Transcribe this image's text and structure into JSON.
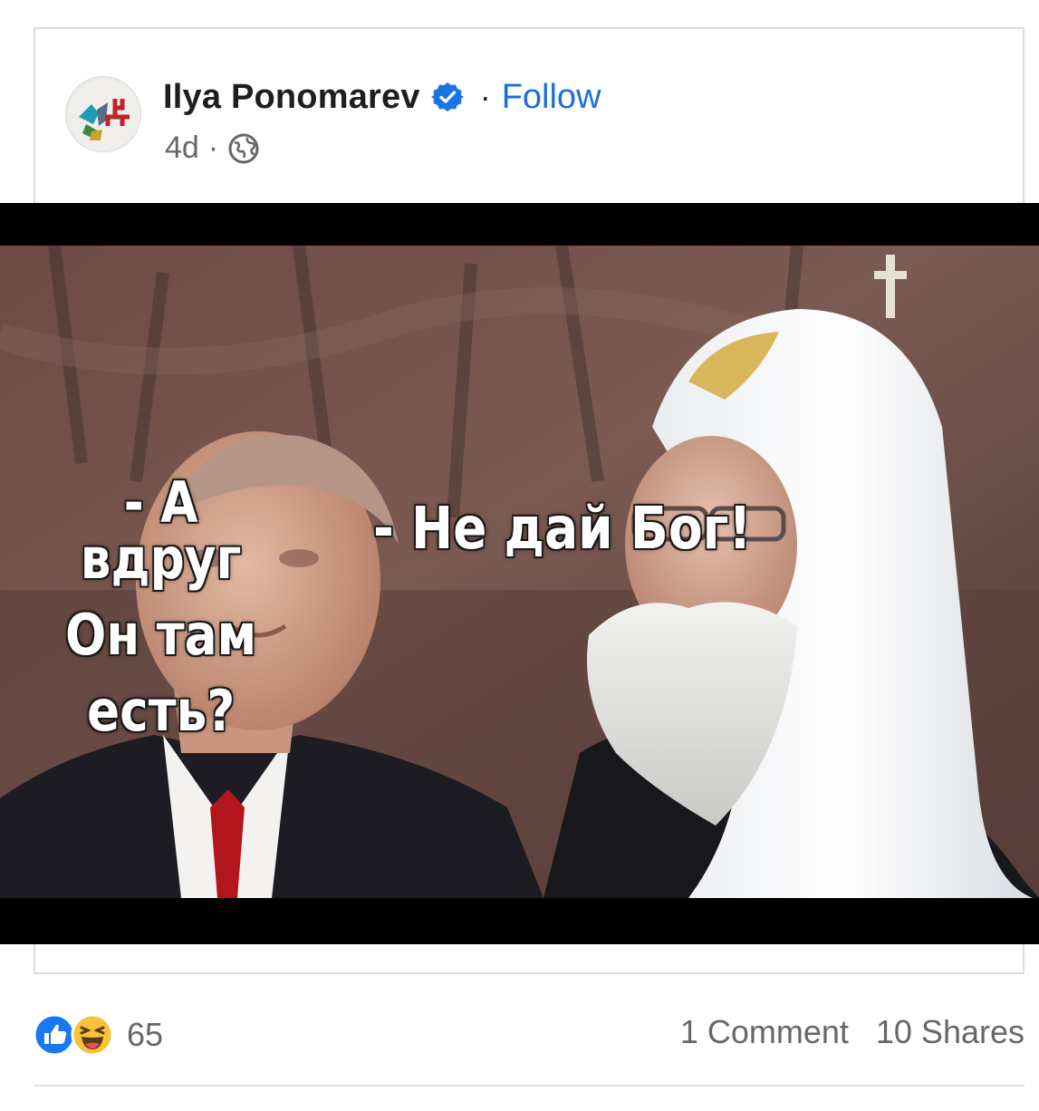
{
  "post": {
    "author": "Ilya Ponomarev",
    "verified_icon": "verified-badge-icon",
    "separator": "·",
    "follow_label": "Follow",
    "time": "4d",
    "meta_separator": "·",
    "audience_icon": "globe-icon"
  },
  "image": {
    "caption_left_lines": [
      "- А вдруг",
      "Он там",
      "есть?"
    ],
    "caption_right": "- Не дай Бог!"
  },
  "footer": {
    "reaction_icons": [
      "like-icon",
      "haha-icon"
    ],
    "reaction_count": "65",
    "comments": "1 Comment",
    "shares": "10 Shares"
  },
  "colors": {
    "link_blue": "#1b6fd8",
    "text_dark": "#1c1e21",
    "text_gray": "#65676b"
  }
}
